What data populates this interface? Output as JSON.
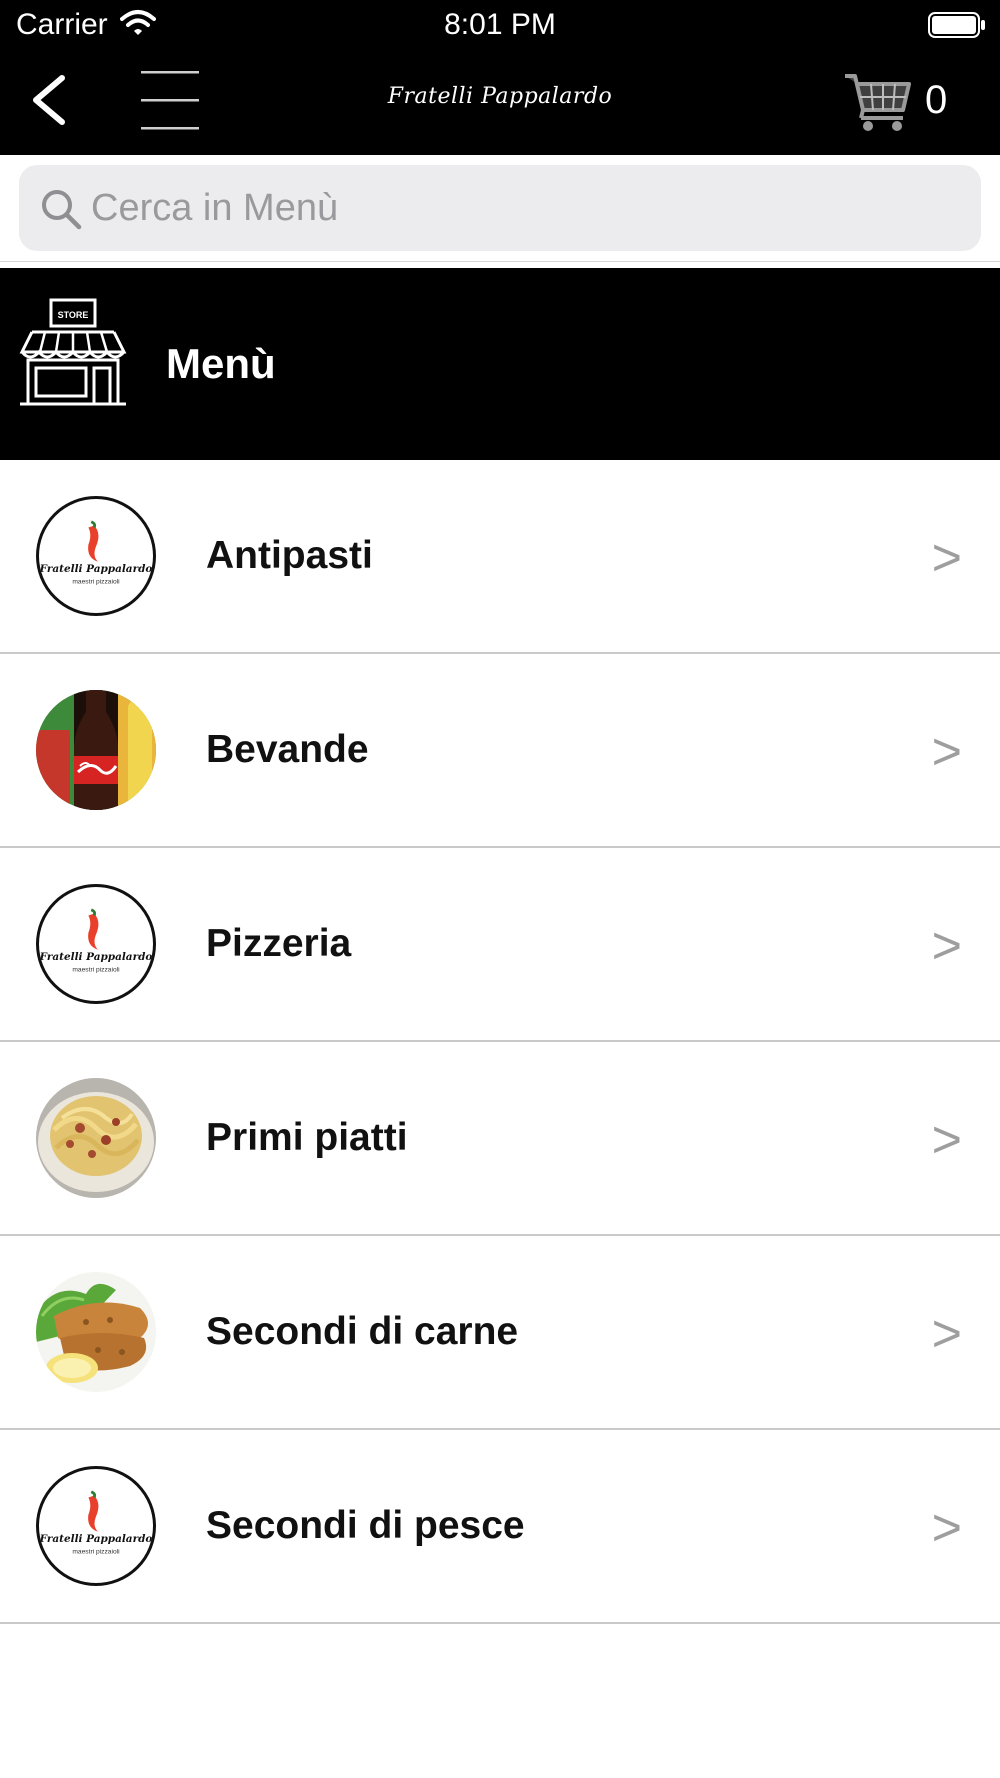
{
  "status_bar": {
    "carrier": "Carrier",
    "time": "8:01 PM"
  },
  "nav": {
    "brand": "Fratelli Pappalardo",
    "cart_count": "0"
  },
  "search": {
    "placeholder": "Cerca in Menù"
  },
  "section": {
    "title": "Menù",
    "store_sign": "STORE"
  },
  "logo": {
    "name": "Fratelli Pappalardo",
    "tagline": "maestri pizzaioli"
  },
  "categories": [
    {
      "label": "Antipasti",
      "thumb": "logo"
    },
    {
      "label": "Bevande",
      "thumb": "drinks"
    },
    {
      "label": "Pizzeria",
      "thumb": "logo"
    },
    {
      "label": "Primi piatti",
      "thumb": "pasta"
    },
    {
      "label": "Secondi di carne",
      "thumb": "cutlet"
    },
    {
      "label": "Secondi di pesce",
      "thumb": "logo"
    }
  ],
  "chevron": ">",
  "colors": {
    "bar": "#000000",
    "accent_chili": "#e8402a",
    "chevron": "#9e9e9e",
    "divider": "#c9c9c9"
  }
}
